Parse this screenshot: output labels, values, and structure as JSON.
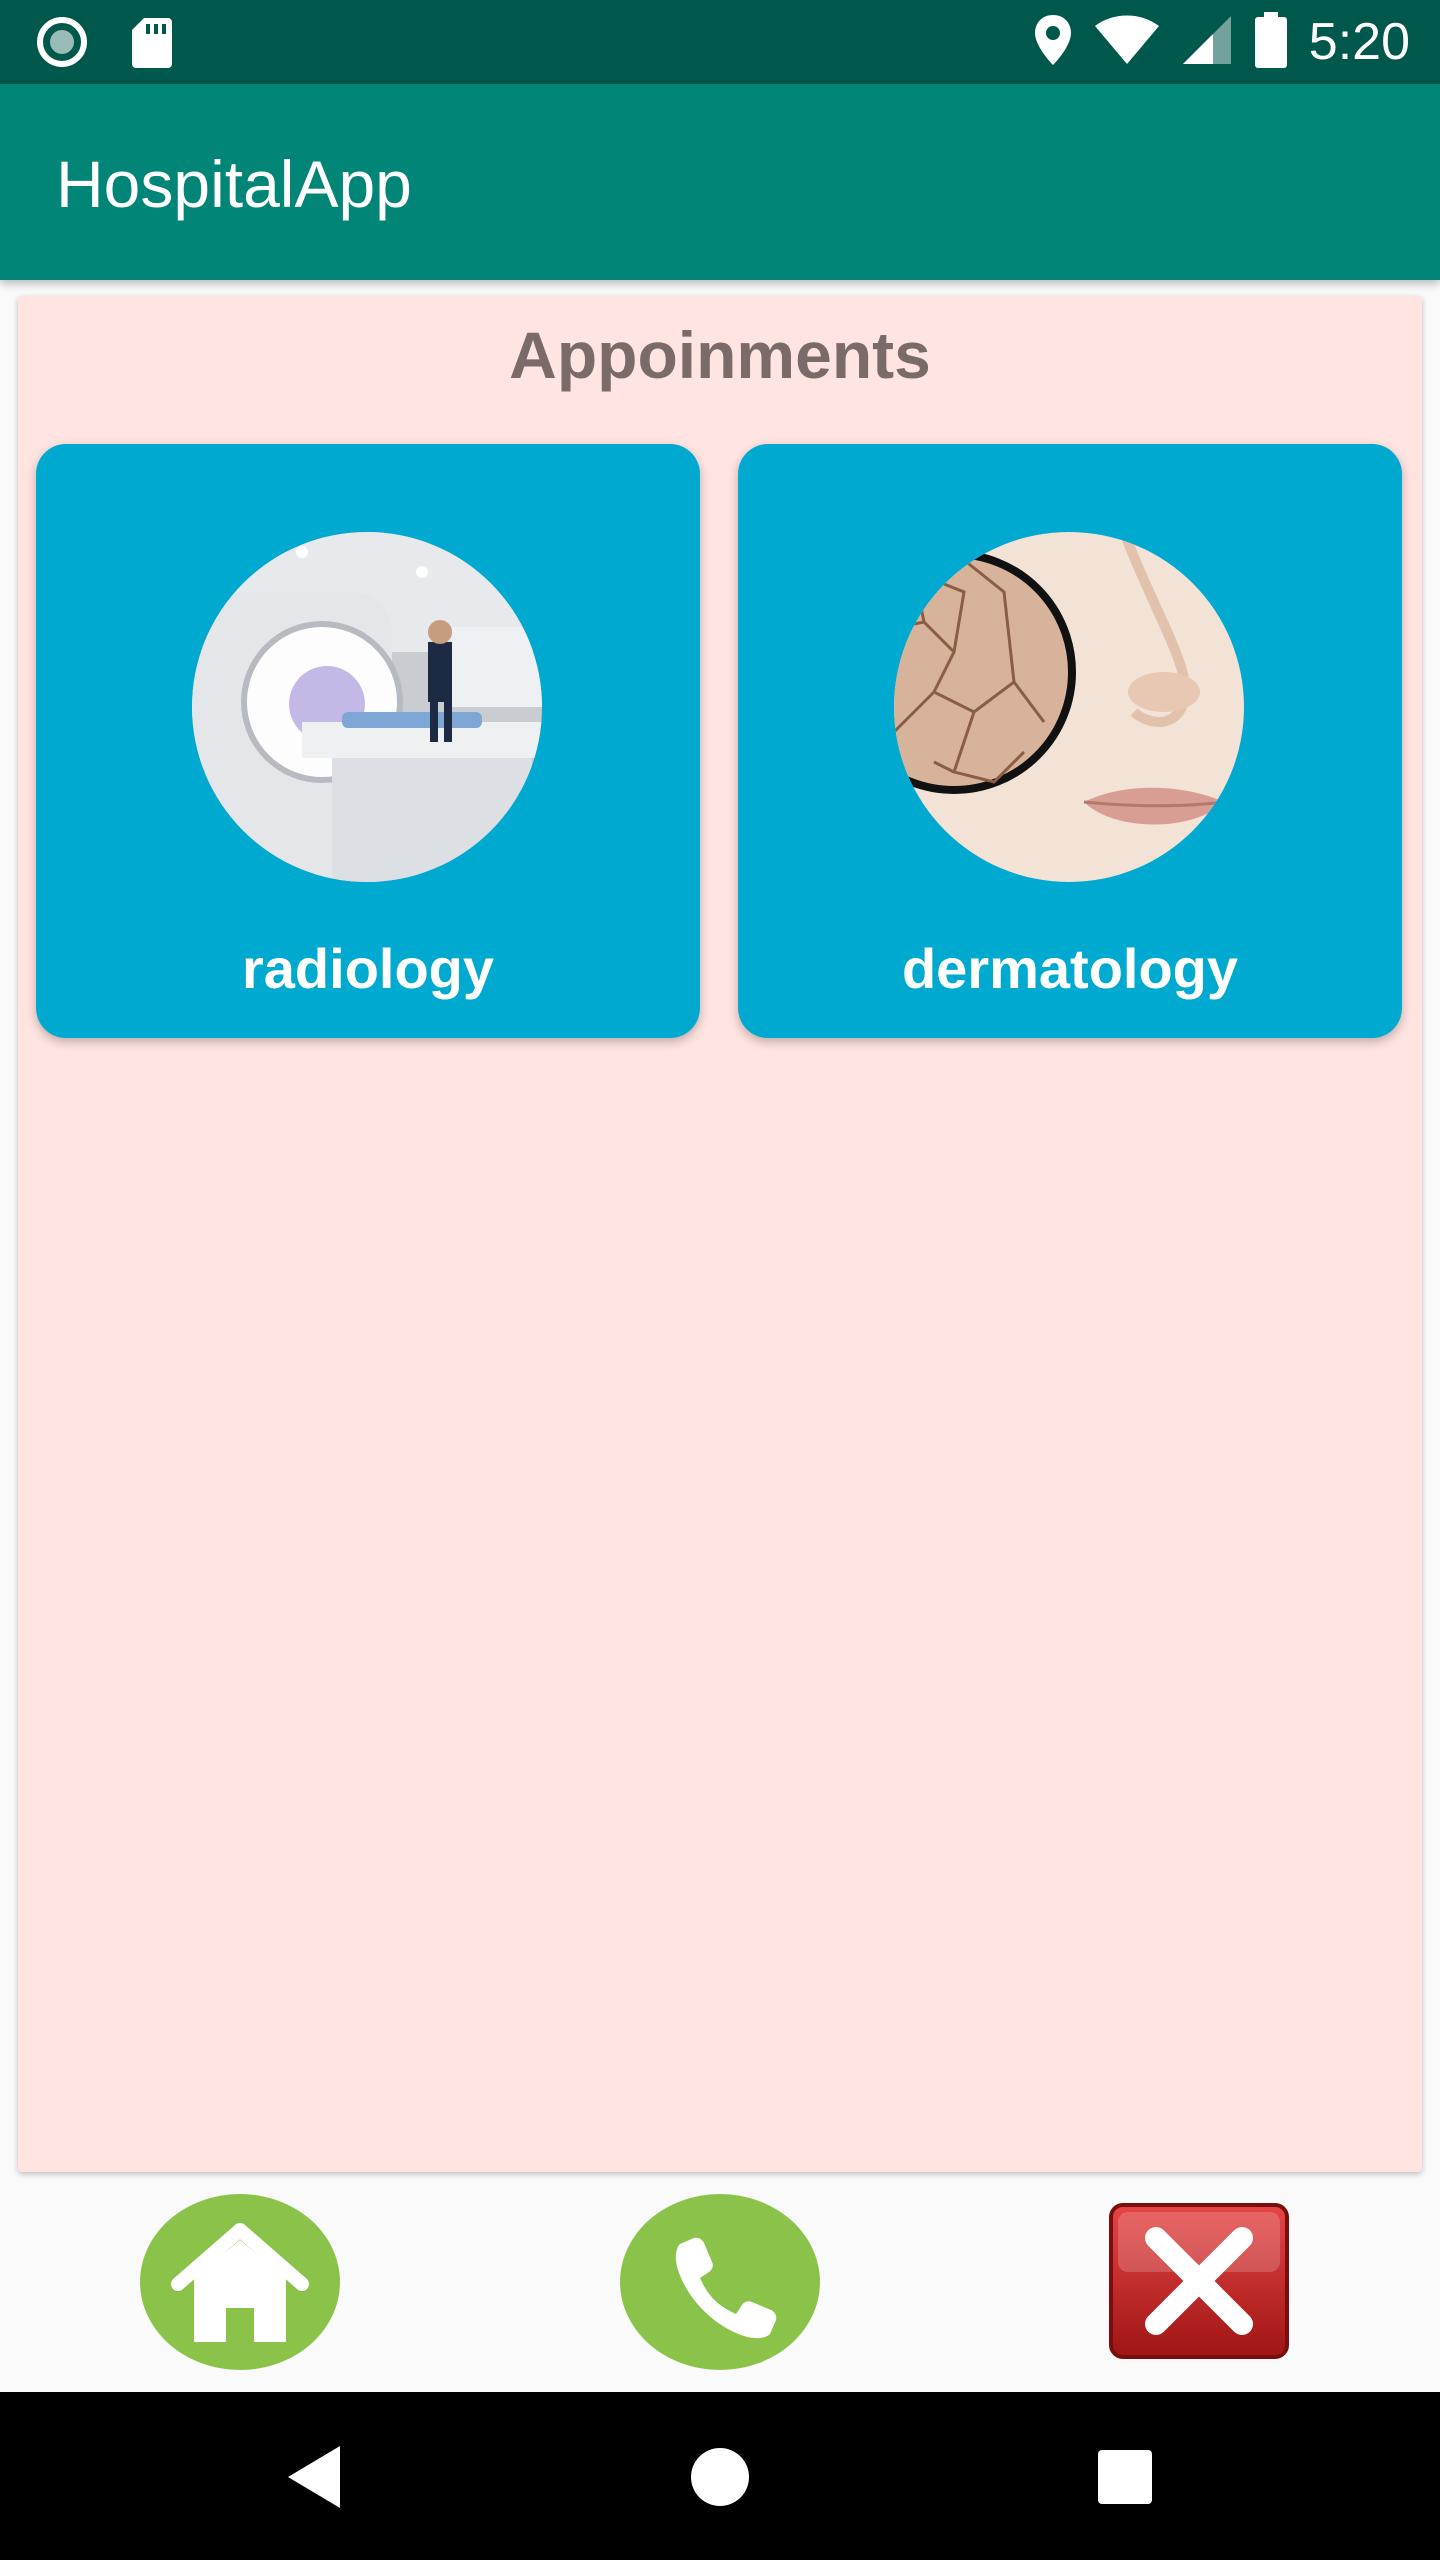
{
  "status_bar": {
    "time": "5:20",
    "icons": [
      "record-icon",
      "sd-card-icon",
      "location-icon",
      "wifi-icon",
      "signal-icon",
      "battery-icon"
    ]
  },
  "app_bar": {
    "title": "HospitalApp"
  },
  "main": {
    "section_title": "Appoinments",
    "cards": [
      {
        "label": "radiology",
        "image": "mri-scanner-photo"
      },
      {
        "label": "dermatology",
        "image": "dry-skin-magnifier-photo"
      }
    ]
  },
  "bottom_actions": {
    "home": "home-icon",
    "call": "phone-icon",
    "close": "close-icon"
  },
  "colors": {
    "status_bar": "#00574b",
    "app_bar": "#008577",
    "panel": "#ffe4e1",
    "card": "#00a9cf",
    "action_green": "#8bc34a",
    "close_red": "#c62828"
  }
}
